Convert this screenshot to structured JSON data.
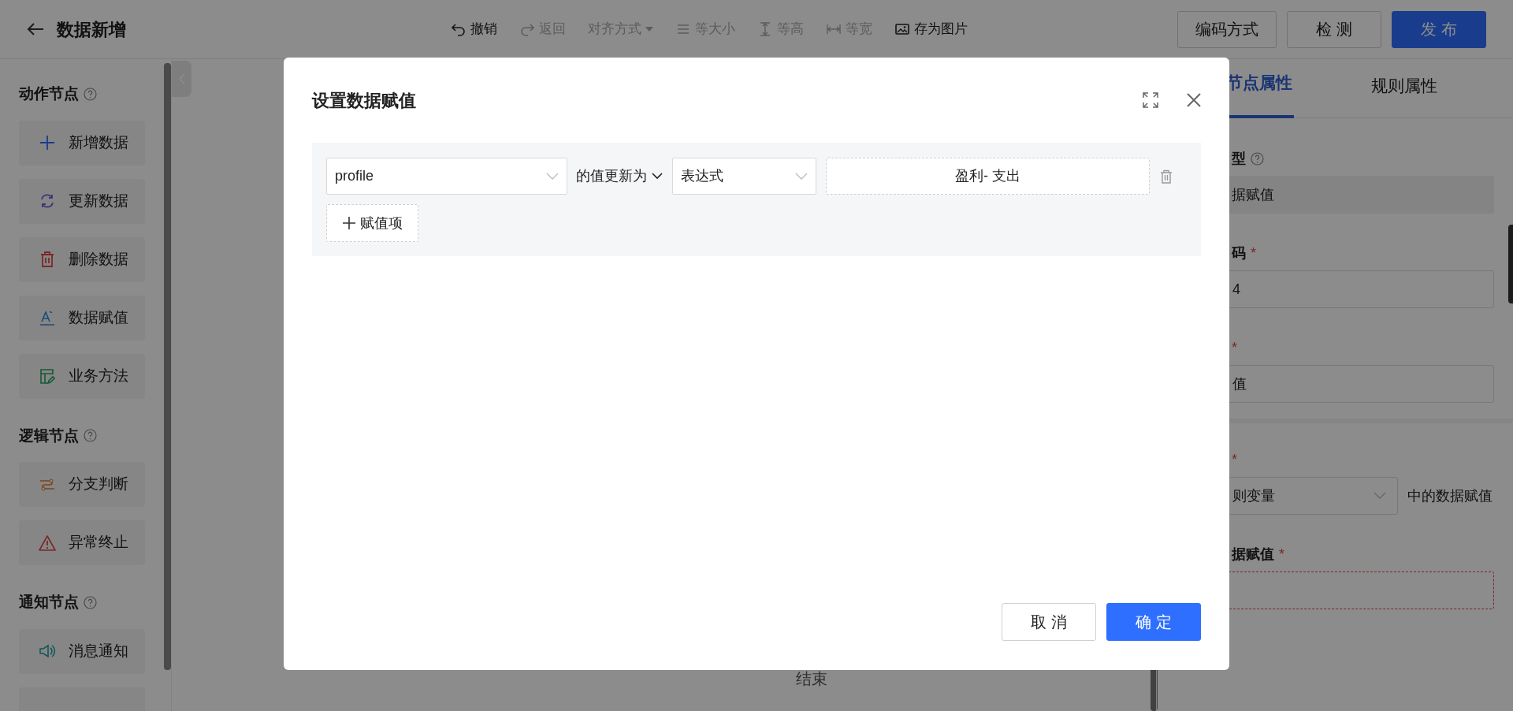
{
  "header": {
    "title": "数据新增"
  },
  "toolbar": [
    {
      "kind": "undo",
      "label": "撤销",
      "disabled": false
    },
    {
      "kind": "redo",
      "label": "返回",
      "disabled": true
    },
    {
      "kind": "align",
      "label": "对齐方式",
      "disabled": true
    },
    {
      "kind": "same-size",
      "label": "等大小",
      "disabled": true
    },
    {
      "kind": "same-height",
      "label": "等高",
      "disabled": true
    },
    {
      "kind": "same-width",
      "label": "等宽",
      "disabled": true
    },
    {
      "kind": "image",
      "label": "存为图片",
      "disabled": false
    }
  ],
  "actions": [
    {
      "label": "编码方式",
      "kind": "default"
    },
    {
      "label": "检 测",
      "kind": "default"
    },
    {
      "label": "发 布",
      "kind": "primary"
    }
  ],
  "sidebar": {
    "sections": [
      {
        "title": "动作节点",
        "items": [
          {
            "kind": "add",
            "label": "新增数据"
          },
          {
            "kind": "refresh",
            "label": "更新数据"
          },
          {
            "kind": "delete",
            "label": "删除数据"
          },
          {
            "kind": "assign",
            "label": "数据赋值"
          },
          {
            "kind": "method",
            "label": "业务方法"
          }
        ]
      },
      {
        "title": "逻辑节点",
        "items": [
          {
            "kind": "branch",
            "label": "分支判断"
          },
          {
            "kind": "abort",
            "label": "异常终止"
          }
        ]
      },
      {
        "title": "通知节点",
        "items": [
          {
            "kind": "notify",
            "label": "消息通知"
          }
        ]
      }
    ]
  },
  "canvas": {
    "node_label": "结束"
  },
  "properties": {
    "tabs": [
      {
        "label": "节点属性",
        "selected": true
      },
      {
        "label": "规则属性",
        "selected": false
      }
    ],
    "fields": [
      {
        "kind": "label",
        "text": "型",
        "help": true
      },
      {
        "kind": "readonly",
        "value": "据赋值"
      },
      {
        "kind": "label",
        "text": "码",
        "help": false,
        "mark": "*"
      },
      {
        "kind": "input",
        "value": "4"
      },
      {
        "kind": "label",
        "help": false,
        "mark": "*"
      },
      {
        "kind": "input",
        "value": "值"
      },
      {
        "kind": "divider"
      },
      {
        "kind": "label",
        "help": false,
        "mark": "*"
      },
      {
        "kind": "select",
        "value": "则变量",
        "suffix": "中的数据赋值"
      },
      {
        "kind": "label",
        "text": "据赋值",
        "help": false,
        "mark": "*"
      },
      {
        "kind": "dashed"
      }
    ]
  },
  "dialog": {
    "title": "设置数据赋值",
    "rows": [
      {
        "field": "profile",
        "connector": "的值更新为",
        "mode": "表达式",
        "expression": "盈利- 支出"
      }
    ],
    "add_button": "赋值项",
    "buttons": [
      {
        "label": "取 消",
        "kind": "default"
      },
      {
        "label": "确 定",
        "kind": "primary"
      }
    ]
  }
}
